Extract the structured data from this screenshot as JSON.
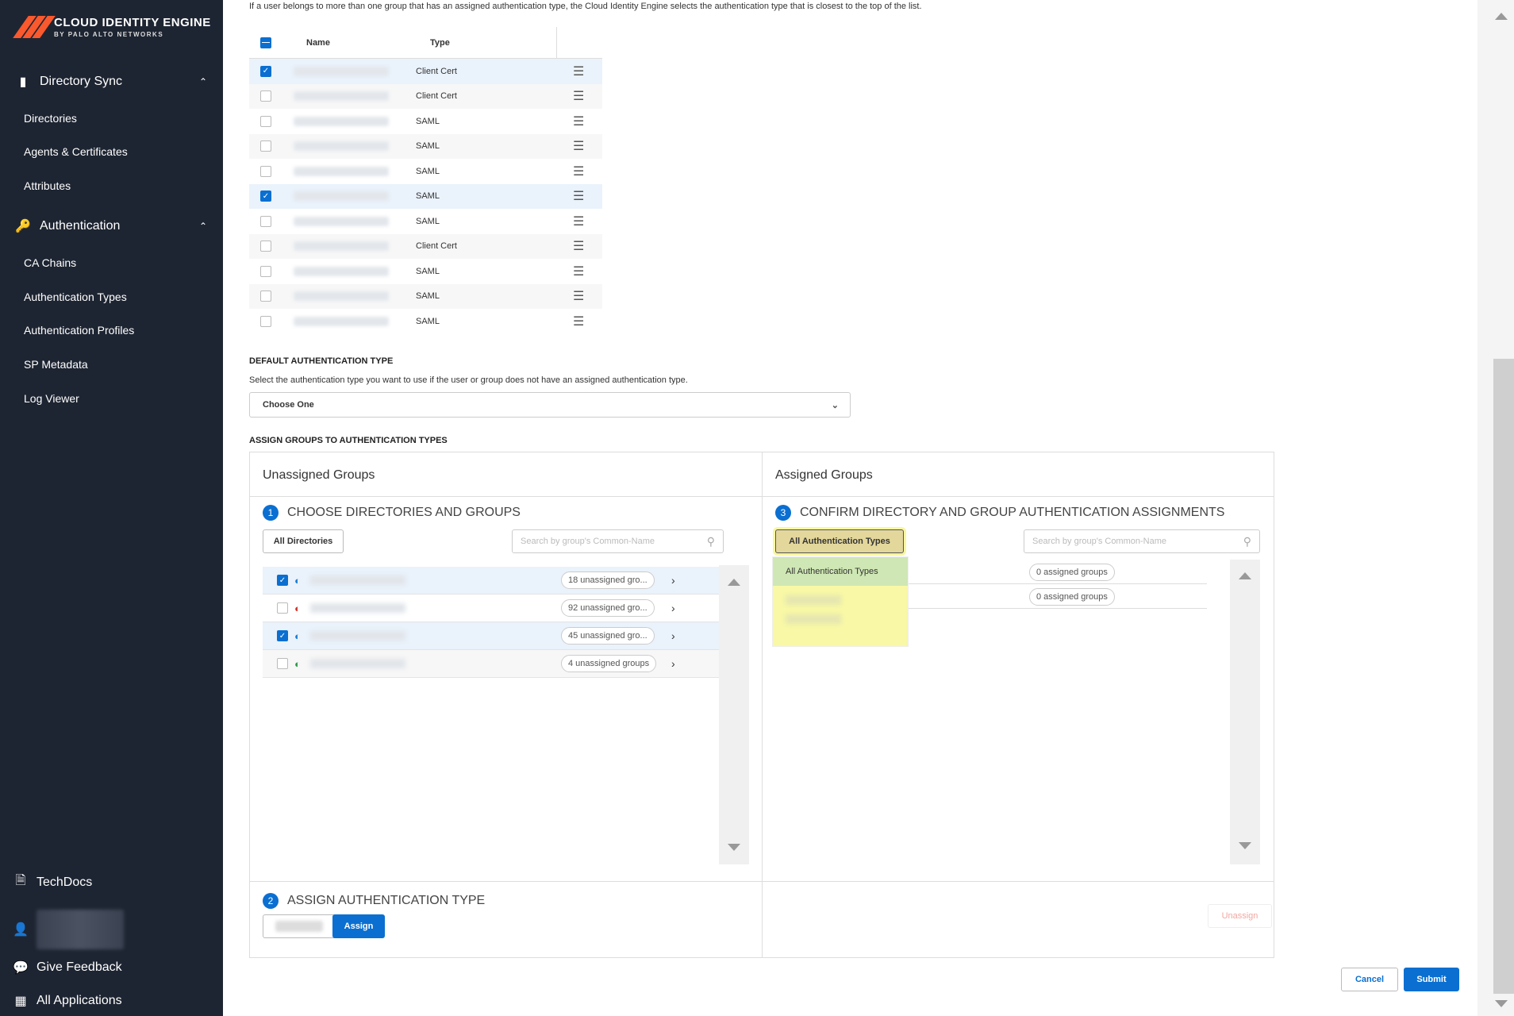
{
  "brand": {
    "title": "CLOUD IDENTITY ENGINE",
    "subtitle": "BY PALO ALTO NETWORKS",
    "accent": "#fa582d"
  },
  "sidebar": {
    "sections": [
      {
        "label": "Directory Sync",
        "icon": "book-icon",
        "items": [
          "Directories",
          "Agents & Certificates",
          "Attributes"
        ]
      },
      {
        "label": "Authentication",
        "icon": "key-icon",
        "items": [
          "CA Chains",
          "Authentication Types",
          "Authentication Profiles",
          "SP Metadata",
          "Log Viewer"
        ]
      }
    ],
    "bottom": {
      "techdocs": "TechDocs",
      "feedback": "Give Feedback",
      "apps": "All Applications"
    }
  },
  "intro_text": "If a user belongs to more than one group that has an assigned authentication type, the Cloud Identity Engine selects the authentication type that is closest to the top of the list.",
  "order_table": {
    "headers": {
      "name": "Name",
      "type": "Type"
    },
    "rows": [
      {
        "type": "Client Cert",
        "checked": true
      },
      {
        "type": "Client Cert",
        "checked": false
      },
      {
        "type": "SAML",
        "checked": false
      },
      {
        "type": "SAML",
        "checked": false
      },
      {
        "type": "SAML",
        "checked": false
      },
      {
        "type": "SAML",
        "checked": true
      },
      {
        "type": "SAML",
        "checked": false
      },
      {
        "type": "Client Cert",
        "checked": false
      },
      {
        "type": "SAML",
        "checked": false
      },
      {
        "type": "SAML",
        "checked": false
      },
      {
        "type": "SAML",
        "checked": false
      }
    ]
  },
  "default_auth": {
    "title": "DEFAULT AUTHENTICATION TYPE",
    "description": "Select the authentication type you want to use if the user or group does not have an assigned authentication type.",
    "select_value": "Choose One"
  },
  "assign_section": {
    "title": "ASSIGN GROUPS TO AUTHENTICATION TYPES"
  },
  "left_panel": {
    "title": "Unassigned Groups",
    "step1": {
      "num": "1",
      "label": "CHOOSE DIRECTORIES AND GROUPS"
    },
    "directories_button": "All Directories",
    "search_placeholder": "Search by group's Common-Name",
    "directories": [
      {
        "checked": true,
        "status_color": "#1a7fd4",
        "count": "18 unassigned gro..."
      },
      {
        "checked": false,
        "status_color": "#d0342c",
        "count": "92 unassigned gro..."
      },
      {
        "checked": true,
        "status_color": "#1a7fd4",
        "count": "45 unassigned gro..."
      },
      {
        "checked": false,
        "status_color": "#2e9a4b",
        "count": "4 unassigned groups"
      }
    ],
    "step2": {
      "num": "2",
      "label": "ASSIGN AUTHENTICATION TYPE"
    },
    "assign_button": "Assign"
  },
  "right_panel": {
    "title": "Assigned Groups",
    "step3": {
      "num": "3",
      "label": "CONFIRM DIRECTORY AND GROUP AUTHENTICATION ASSIGNMENTS"
    },
    "filter_button": "All Authentication Types",
    "filter_options": [
      "All Authentication Types"
    ],
    "search_placeholder": "Search by group's Common-Name",
    "assigned": [
      "0 assigned groups",
      "0 assigned groups"
    ],
    "unassign_button": "Unassign"
  },
  "footer": {
    "cancel": "Cancel",
    "submit": "Submit"
  }
}
